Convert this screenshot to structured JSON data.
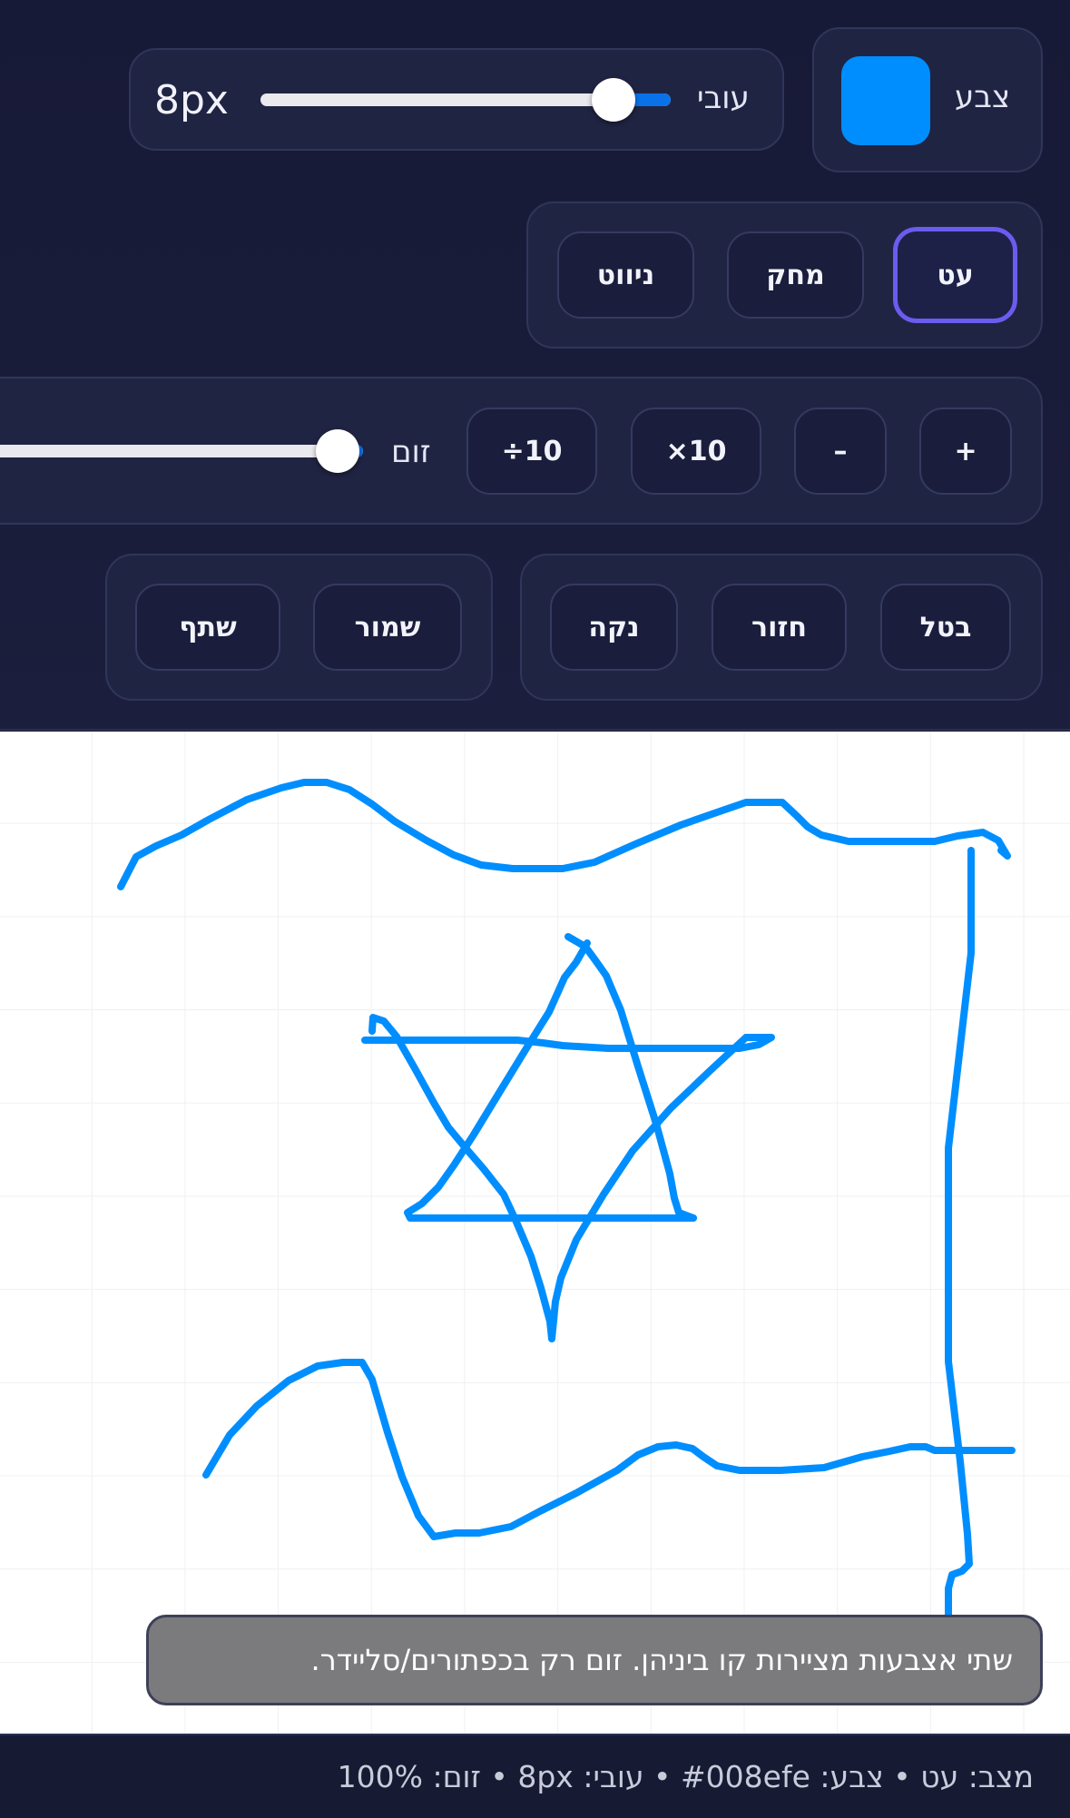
{
  "color_panel": {
    "label": "צבע",
    "current_color": "#008efe"
  },
  "size_panel": {
    "label": "עובי",
    "value_label": "8px",
    "slider_fraction": 0.86
  },
  "tools": [
    {
      "label": "עט",
      "active": true
    },
    {
      "label": "מחק",
      "active": false
    },
    {
      "label": "ניווט",
      "active": false
    }
  ],
  "zoom_panel": {
    "zoom_in_label": "+",
    "zoom_out_label": "–",
    "times10_label": "10×",
    "div10_label": "10÷",
    "label": "זום"
  },
  "edit_panel": {
    "undo_label": "בטל",
    "redo_label": "חזור",
    "clear_label": "נקה"
  },
  "file_panel": {
    "save_label": "שמור",
    "share_label": "שתף"
  },
  "toast": {
    "text": "שתי אצבעות מציירות קו ביניהן. זום רק בכפתורים/סליידר."
  },
  "status": {
    "text": "מצב: עט • צבע: #008efe • עובי: 8px • זום: 100%"
  },
  "colors": {
    "stroke": "#008efe",
    "toolbar_bg": "#1a1d3a",
    "active_border": "#6b5cf0",
    "slider_fill": "#0a72e8"
  }
}
